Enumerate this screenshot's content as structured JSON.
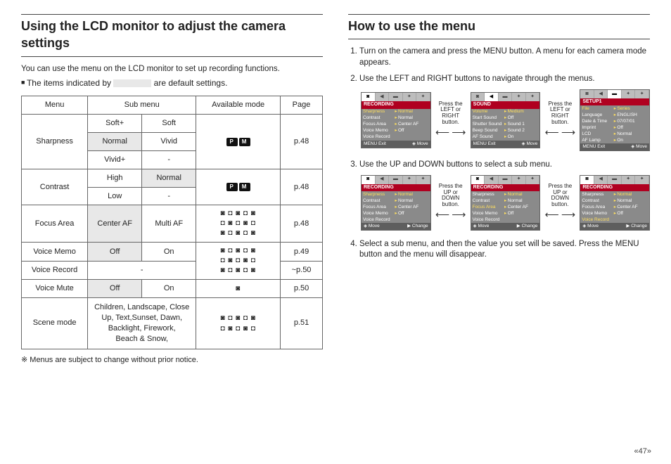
{
  "headings": {
    "left": "Using the LCD monitor to adjust the camera settings",
    "right": "How to use the menu"
  },
  "left": {
    "intro": "You can use the menu on the LCD monitor to set up recording functions.",
    "bullet_pre": "The items indicated by ",
    "bullet_post": " are default settings.",
    "table": {
      "headers": {
        "menu": "Menu",
        "sub": "Sub menu",
        "mode": "Available mode",
        "page": "Page"
      },
      "sharpness": {
        "label": "Sharpness",
        "r1a": "Soft+",
        "r1b": "Soft",
        "r2a": "Normal",
        "r2b": "Vivid",
        "r3a": "Vivid+",
        "r3b": "-",
        "page": "p.48"
      },
      "contrast": {
        "label": "Contrast",
        "r1a": "High",
        "r1b": "Normal",
        "r2a": "Low",
        "r2b": "-",
        "page": "p.48"
      },
      "focus": {
        "label": "Focus Area",
        "a": "Center AF",
        "b": "Multi AF",
        "page": "p.48"
      },
      "memo": {
        "label": "Voice Memo",
        "a": "Off",
        "b": "On",
        "page": "p.49"
      },
      "record": {
        "label": "Voice Record",
        "val": "-",
        "page": "~p.50"
      },
      "mute": {
        "label": "Voice Mute",
        "a": "Off",
        "b": "On",
        "page": "p.50"
      },
      "scene": {
        "label": "Scene mode",
        "val": "Children, Landscape, Close Up, Text,Sunset, Dawn, Backlight, Firework,\nBeach & Snow,",
        "page": "p.51"
      }
    },
    "footnote": "Menus are subject to change without prior notice."
  },
  "right": {
    "step1": "Turn on the camera and press the MENU button. A menu for each camera mode appears.",
    "step2": "Use the LEFT and RIGHT buttons to navigate through the menus.",
    "lr_caption": "Press the LEFT or RIGHT button.",
    "step3": "Use the UP and DOWN buttons to select a sub menu.",
    "ud_caption": "Press the UP or DOWN button.",
    "step4": "Select a sub menu, and then the value you set will be saved. Press the MENU button and the menu will disappear."
  },
  "lcd": {
    "recording": {
      "title": "RECORDING",
      "rows": [
        {
          "k": "Sharpness",
          "v": "Normal"
        },
        {
          "k": "Contrast",
          "v": "Normal"
        },
        {
          "k": "Focus Area",
          "v": "Center AF"
        },
        {
          "k": "Voice Memo",
          "v": "Off"
        },
        {
          "k": "Voice Record",
          "v": ""
        }
      ],
      "footL": "MENU Exit",
      "footR": "Move"
    },
    "sound": {
      "title": "SOUND",
      "rows": [
        {
          "k": "Volume",
          "v": "Medium"
        },
        {
          "k": "Start Sound",
          "v": "Off"
        },
        {
          "k": "Shutter Sound",
          "v": "Sound 1"
        },
        {
          "k": "Beep Sound",
          "v": "Sound 2"
        },
        {
          "k": "AF Sound",
          "v": "On"
        }
      ],
      "footL": "MENU Exit",
      "footR": "Move"
    },
    "setup": {
      "title": "SETUP1",
      "rows": [
        {
          "k": "File",
          "v": "Series"
        },
        {
          "k": "Language",
          "v": "ENGLISH"
        },
        {
          "k": "Date & Time",
          "v": "07/07/01"
        },
        {
          "k": "Imprint",
          "v": "Off"
        },
        {
          "k": "LCD",
          "v": "Normal"
        },
        {
          "k": "AF Lamp",
          "v": "On"
        }
      ],
      "footL": "MENU Exit",
      "footR": "Move"
    },
    "recFootAlt": {
      "footL": "Move",
      "footR": "Change"
    }
  },
  "mode_labels": {
    "p": "P",
    "m": "M"
  },
  "page_number": "47"
}
